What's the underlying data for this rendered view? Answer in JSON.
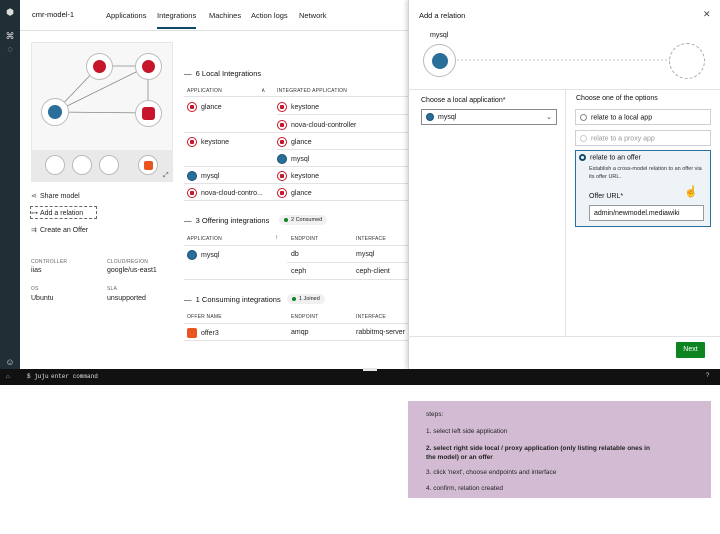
{
  "header": {
    "model_name": "cmr-model-1",
    "tabs": [
      {
        "label": "Applications"
      },
      {
        "label": "Integrations"
      },
      {
        "label": "Machines"
      },
      {
        "label": "Action logs"
      },
      {
        "label": "Network"
      }
    ]
  },
  "sidebar_actions": [
    {
      "label": "Share model",
      "icon": "share-icon"
    },
    {
      "label": "Add a relation",
      "icon": "relation-icon"
    },
    {
      "label": "Create an Offer",
      "icon": "offer-icon"
    }
  ],
  "model_meta": {
    "controller_label": "CONTROLLER",
    "controller": "iias",
    "cloud_label": "CLOUD/REGION",
    "cloud": "google/us-east1",
    "os_label": "OS",
    "os": "Ubuntu",
    "sla_label": "SLA",
    "sla": "unsupported"
  },
  "local_integrations": {
    "title": "6 Local Integrations",
    "col_app": "APPLICATION",
    "col_integrated": "INTEGRATED APPLICATION",
    "rows": [
      {
        "app": "glance",
        "integrated": "keystone"
      },
      {
        "app": "",
        "integrated": "nova-cloud-controller"
      },
      {
        "app": "keystone",
        "integrated": "glance"
      },
      {
        "app": "",
        "integrated": "mysql"
      },
      {
        "app": "mysql",
        "integrated": "keystone"
      },
      {
        "app": "nova-cloud-contro...",
        "integrated": "glance"
      }
    ]
  },
  "offering_integrations": {
    "title": "3 Offering integrations",
    "badge": "2 Consumed",
    "col_app": "APPLICATION",
    "col_endpoint": "ENDPOINT",
    "col_interface": "INTERFACE",
    "rows": [
      {
        "app": "mysql",
        "endpoint": "db",
        "interface": "mysql"
      },
      {
        "app": "",
        "endpoint": "ceph",
        "interface": "ceph-client"
      }
    ]
  },
  "consuming_integrations": {
    "title": "1 Consuming integrations",
    "badge": "1 Joined",
    "col_offer": "OFFER NAME",
    "col_endpoint": "ENDPOINT",
    "col_interface": "INTERFACE",
    "rows": [
      {
        "offer": "offer3",
        "endpoint": "amqp",
        "interface": "rabbitmq-server"
      }
    ]
  },
  "panel": {
    "title": "Add a relation",
    "left_app": "mysql",
    "choose_local_label": "Choose a local application*",
    "selected_app": "mysql",
    "options_label": "Choose one of the options",
    "option_local": "relate to a local app",
    "option_proxy": "relate to a proxy app",
    "option_offer": "relate to an offer",
    "offer_help": "Establish a cross-model relation to an offer via its offer URL.",
    "offer_url_label": "Offer URL*",
    "offer_url_value": "admin/newmodel.mediawiki",
    "next_label": "Next"
  },
  "terminal": {
    "prompt": "$ juju",
    "placeholder": "enter command"
  },
  "notes": {
    "title": "steps:",
    "step1": "1. select left side application",
    "step2a": "2. select right side local / proxy application (only listing relatable ones in",
    "step2b": "the model) or an offer",
    "step3": "3. click 'next', choose endpoints and interface",
    "step4": "4. confirm, relation created"
  },
  "colors": {
    "sidebar": "#202e36",
    "accent": "#0f4a6a",
    "success": "#0e8420",
    "notes_bg": "#d3bcd3"
  }
}
